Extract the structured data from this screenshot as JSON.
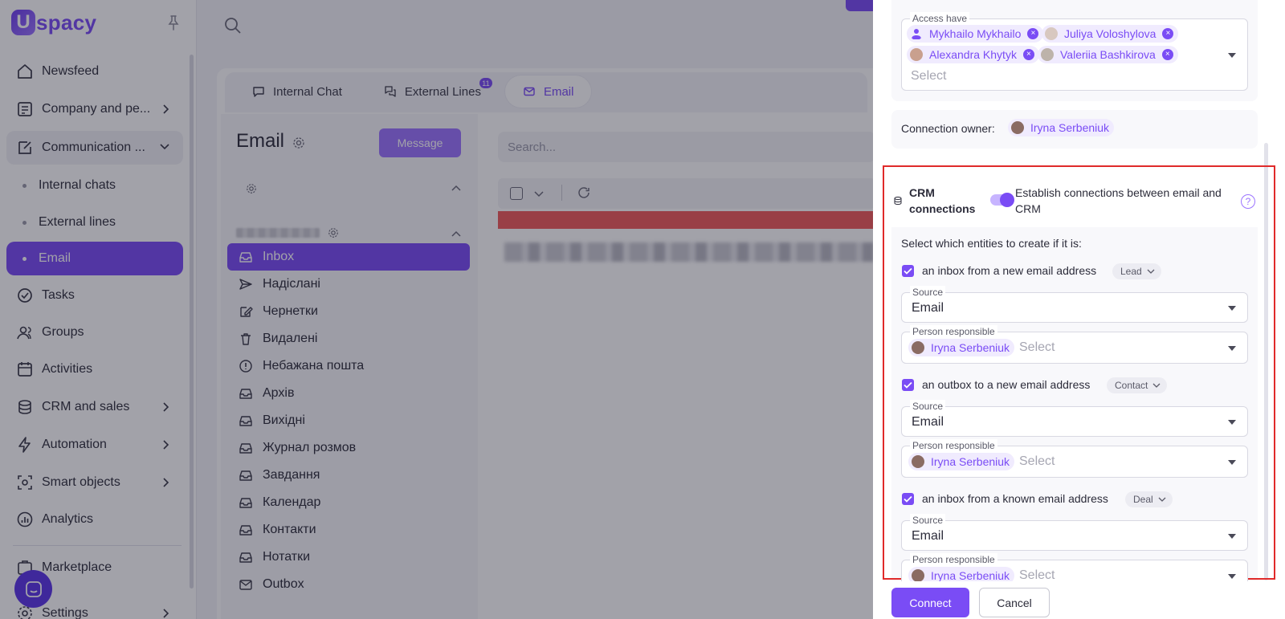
{
  "app": {
    "logo_letter": "U",
    "logo_text": "spacy"
  },
  "sidebar": {
    "items": [
      {
        "label": "Newsfeed",
        "icon": "home-icon"
      },
      {
        "label": "Company and pe...",
        "icon": "company-icon"
      },
      {
        "label": "Communication ...",
        "icon": "communication-icon"
      },
      {
        "label": "Internal chats"
      },
      {
        "label": "External lines"
      },
      {
        "label": "Email"
      },
      {
        "label": "Tasks",
        "icon": "tasks-icon"
      },
      {
        "label": "Groups",
        "icon": "groups-icon"
      },
      {
        "label": "Activities",
        "icon": "calendar-icon"
      },
      {
        "label": "CRM and sales",
        "icon": "crm-icon"
      },
      {
        "label": "Automation",
        "icon": "lightning-icon"
      },
      {
        "label": "Smart objects",
        "icon": "smart-objects-icon"
      },
      {
        "label": "Analytics",
        "icon": "analytics-icon"
      },
      {
        "label": "Marketplace",
        "icon": "marketplace-icon"
      },
      {
        "label": "Settings",
        "icon": "settings-icon"
      }
    ]
  },
  "tabs": [
    {
      "label": "Internal Chat",
      "icon": "chat-icon"
    },
    {
      "label": "External Lines",
      "icon": "external-lines-icon",
      "badge": "11"
    },
    {
      "label": "Email",
      "icon": "mail-icon"
    }
  ],
  "mail": {
    "title": "Email",
    "message_button": "Message",
    "search_placeholder": "Search...",
    "folders": [
      {
        "label": "Inbox",
        "icon": "inbox-icon"
      },
      {
        "label": "Надіслані",
        "icon": "send-icon"
      },
      {
        "label": "Чернетки",
        "icon": "draft-icon"
      },
      {
        "label": "Видалені",
        "icon": "trash-icon"
      },
      {
        "label": "Небажана пошта",
        "icon": "spam-icon"
      },
      {
        "label": "Архів",
        "icon": "inbox-icon"
      },
      {
        "label": "Вихідні",
        "icon": "inbox-icon"
      },
      {
        "label": "Журнал розмов",
        "icon": "inbox-icon"
      },
      {
        "label": "Завдання",
        "icon": "inbox-icon"
      },
      {
        "label": "Календар",
        "icon": "inbox-icon"
      },
      {
        "label": "Контакти",
        "icon": "inbox-icon"
      },
      {
        "label": "Нотатки",
        "icon": "inbox-icon"
      },
      {
        "label": "Outbox",
        "icon": "outbox-icon"
      }
    ]
  },
  "drawer": {
    "access_have": {
      "label": "Access have",
      "placeholder": "Select",
      "users": [
        "Mykhailo Mykhailo",
        "Juliya Voloshylova",
        "Alexandra Khytyk",
        "Valeriia Bashkirova"
      ]
    },
    "owner": {
      "label": "Connection owner:",
      "name": "Iryna Serbeniuk"
    },
    "crm": {
      "title": "CRM connections",
      "toggle_on": true,
      "description": "Establish connections between email and CRM",
      "help": "?",
      "select_entities": "Select which entities to create if it is:",
      "rules": [
        {
          "label": "an inbox from a new email address",
          "entity": "Lead",
          "source_label": "Source",
          "source": "Email",
          "person_label": "Person responsible",
          "person": "Iryna Serbeniuk",
          "person_placeholder": "Select"
        },
        {
          "label": "an outbox to a new email address",
          "entity": "Contact",
          "source_label": "Source",
          "source": "Email",
          "person_label": "Person responsible",
          "person": "Iryna Serbeniuk",
          "person_placeholder": "Select"
        },
        {
          "label": "an inbox from a known email address",
          "entity": "Deal",
          "source_label": "Source",
          "source": "Email",
          "person_label": "Person responsible",
          "person": "Iryna Serbeniuk",
          "person_placeholder": "Select"
        }
      ]
    },
    "buttons": {
      "connect": "Connect",
      "cancel": "Cancel"
    }
  },
  "colors": {
    "accent": "#7a4cf5",
    "accent_light": "#f0ebfe",
    "highlight_border": "#e02a2a",
    "overlay": "rgba(22,22,40,0.40)"
  }
}
